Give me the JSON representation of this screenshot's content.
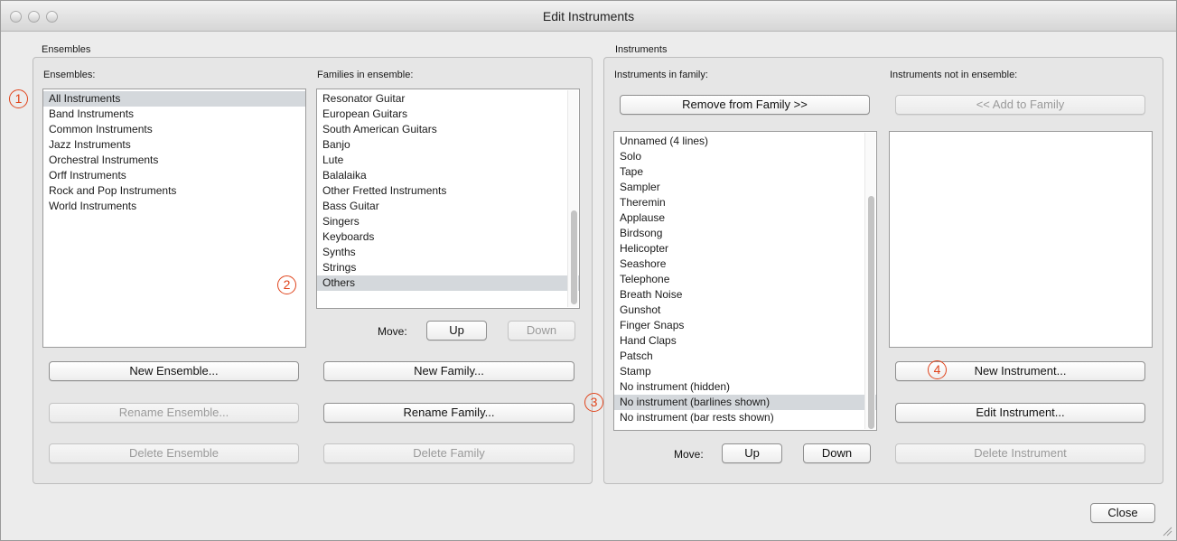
{
  "window": {
    "title": "Edit Instruments"
  },
  "ensembles_group": {
    "title": "Ensembles",
    "ensembles_label": "Ensembles:",
    "ensembles": [
      "All Instruments",
      "Band Instruments",
      "Common Instruments",
      "Jazz Instruments",
      "Orchestral Instruments",
      "Orff Instruments",
      "Rock and Pop Instruments",
      "World Instruments"
    ],
    "selected_ensemble": "All Instruments",
    "families_label": "Families in ensemble:",
    "families": [
      "Resonator Guitar",
      "European Guitars",
      "South American Guitars",
      "Banjo",
      "Lute",
      "Balalaika",
      "Other Fretted Instruments",
      "Bass Guitar",
      "Singers",
      "Keyboards",
      "Synths",
      "Strings",
      "Others"
    ],
    "selected_family": "Others",
    "move_label": "Move:",
    "up_label": "Up",
    "down_label": "Down",
    "new_ensemble": "New Ensemble...",
    "rename_ensemble": "Rename Ensemble...",
    "delete_ensemble": "Delete Ensemble",
    "new_family": "New Family...",
    "rename_family": "Rename Family...",
    "delete_family": "Delete Family"
  },
  "instruments_group": {
    "title": "Instruments",
    "in_family_label": "Instruments in family:",
    "not_in_ensemble_label": "Instruments not in ensemble:",
    "remove_button": "Remove from Family >>",
    "add_button": "<< Add to Family",
    "instruments": [
      "Unnamed (4 lines)",
      "Solo",
      "Tape",
      "Sampler",
      "Theremin",
      "Applause",
      "Birdsong",
      "Helicopter",
      "Seashore",
      "Telephone",
      "Breath Noise",
      "Gunshot",
      "Finger Snaps",
      "Hand Claps",
      "Patsch",
      "Stamp",
      "No instrument (hidden)",
      "No instrument (barlines shown)",
      "No instrument (bar rests shown)"
    ],
    "selected_instrument": "No instrument (barlines shown)",
    "move_label": "Move:",
    "up_label": "Up",
    "down_label": "Down",
    "new_instrument": "New Instrument...",
    "edit_instrument": "Edit Instrument...",
    "delete_instrument": "Delete Instrument"
  },
  "callouts": [
    "1",
    "2",
    "3",
    "4"
  ],
  "close_button": "Close",
  "colors": {
    "callout": "#e0441c",
    "selection": "#d4d8dc"
  }
}
